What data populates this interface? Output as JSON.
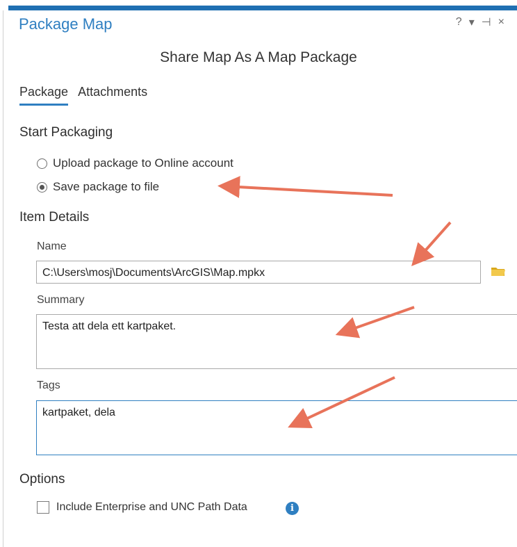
{
  "window": {
    "title": "Package Map",
    "controls": {
      "help": "?",
      "menu": "▾",
      "pin": "⊣",
      "close": "×"
    }
  },
  "subtitle": "Share Map As A Map Package",
  "tabs": [
    {
      "label": "Package",
      "active": true
    },
    {
      "label": "Attachments",
      "active": false
    }
  ],
  "start_packaging": {
    "heading": "Start Packaging",
    "options": [
      {
        "label": "Upload package to Online account",
        "selected": false
      },
      {
        "label": "Save package to file",
        "selected": true
      }
    ]
  },
  "item_details": {
    "heading": "Item Details",
    "name_label": "Name",
    "name_value": "C:\\Users\\mosj\\Documents\\ArcGIS\\Map.mpkx",
    "summary_label": "Summary",
    "summary_value": "Testa att dela ett kartpaket.",
    "tags_label": "Tags",
    "tags_value": "kartpaket, dela"
  },
  "options": {
    "heading": "Options",
    "include_label": "Include Enterprise and UNC Path Data",
    "include_checked": false,
    "info_glyph": "i"
  },
  "colors": {
    "accent": "#2f7fc1",
    "annotation_arrow": "#e8735a",
    "folder": "#e8b923"
  }
}
